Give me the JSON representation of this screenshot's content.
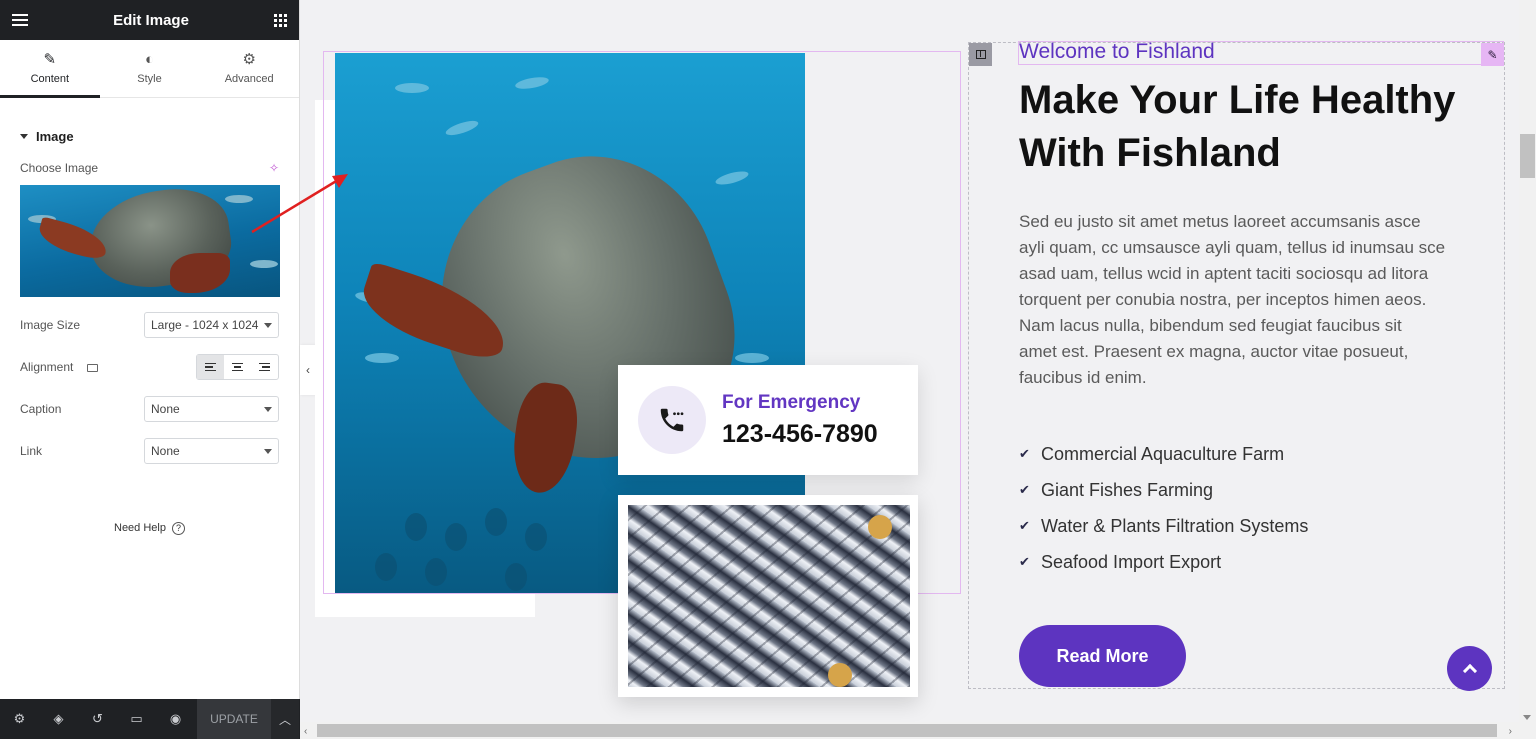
{
  "panel": {
    "title": "Edit Image",
    "tabs": [
      {
        "label": "Content",
        "icon": "pencil-icon",
        "active": true
      },
      {
        "label": "Style",
        "icon": "half-circle-icon",
        "active": false
      },
      {
        "label": "Advanced",
        "icon": "gear-icon",
        "active": false
      }
    ],
    "section_title": "Image",
    "choose_image_label": "Choose Image",
    "image_size": {
      "label": "Image Size",
      "value": "Large - 1024 x 1024"
    },
    "alignment": {
      "label": "Alignment",
      "selected": "left"
    },
    "caption": {
      "label": "Caption",
      "value": "None"
    },
    "link": {
      "label": "Link",
      "value": "None"
    },
    "need_help": "Need Help",
    "footer": {
      "update_label": "UPDATE"
    }
  },
  "canvas": {
    "emergency": {
      "label": "For Emergency",
      "phone": "123-456-7890"
    },
    "subtitle": "Welcome to Fishland",
    "headline_line1": "Make Your Life Healthy",
    "headline_line2": "With Fishland",
    "paragraph_lines": [
      "Sed eu justo sit amet metus laoreet accumsanis asce",
      "ayli quam, cc umsausce ayli quam, tellus id inumsau sce",
      "asad uam, tellus wcid in aptent taciti sociosqu ad litora",
      "torquent per conubia nostra, per inceptos himen aeos.",
      "Nam lacus nulla, bibendum sed feugiat faucibus sit",
      "amet est. Praesent ex magna, auctor vitae posueut,",
      "faucibus id enim."
    ],
    "features": [
      "Commercial Aquaculture Farm",
      "Giant Fishes Farming",
      "Water & Plants Filtration Systems",
      "Seafood Import Export"
    ],
    "read_more": "Read More"
  },
  "colors": {
    "accent": "#5d34c0",
    "panel_dark": "#1f2124",
    "selection": "#e3b8f0",
    "annotation_arrow": "#e02020"
  }
}
